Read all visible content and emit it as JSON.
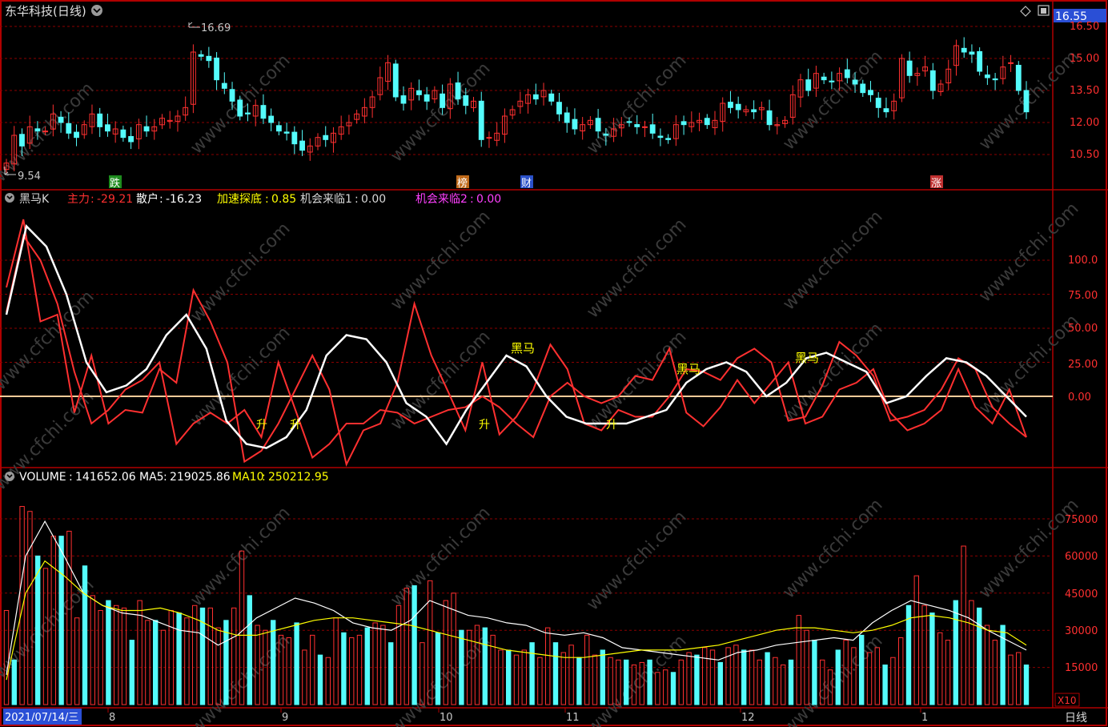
{
  "header": {
    "stock_title": "东华科技(日线)",
    "price_badge": "16.55",
    "high_label": "16.69",
    "low_label": "9.54"
  },
  "price_axis": [
    "16.50",
    "15.00",
    "13.50",
    "12.00",
    "10.50"
  ],
  "event_tags": [
    {
      "text": "跌",
      "color": "#1e8c1e"
    },
    {
      "text": "榜",
      "color": "#c06a1a"
    },
    {
      "text": "财",
      "color": "#2a50c8"
    },
    {
      "text": "涨",
      "color": "#c03030"
    }
  ],
  "indicator": {
    "name": "黑马K",
    "zhuli_label": "主力",
    "zhuli_value": "-29.21",
    "sanhu_label": "散户",
    "sanhu_value": "-16.23",
    "jiasu_label": "加速探底",
    "jiasu_value": "0.85",
    "jihui1_label": "机会来临1",
    "jihui1_value": "0.00",
    "jihui2_label": "机会来临2",
    "jihui2_value": "0.00",
    "axis": [
      "100.0",
      "75.00",
      "50.00",
      "25.00",
      "0.00"
    ],
    "marks": [
      "黑马",
      "黑马",
      "黑马",
      "升",
      "升",
      "升",
      "升"
    ]
  },
  "volume": {
    "label": "VOLUME",
    "value": "141652.06",
    "ma5_label": "MA5",
    "ma5_value": "219025.86",
    "ma10_label": "MA10",
    "ma10_value": "250212.95",
    "axis": [
      "75000",
      "60000",
      "45000",
      "30000",
      "15000"
    ],
    "unit": "X10"
  },
  "date_axis": {
    "current_date": "2021/07/14/三",
    "months": [
      "8",
      "9",
      "10",
      "11",
      "12",
      "1"
    ],
    "period": "日线"
  },
  "watermark": "www.cfchi.com",
  "colors": {
    "up": "#ff3030",
    "down": "#54fcfc",
    "white": "#ffffff",
    "yellow": "#ffff00",
    "magenta": "#ff40ff",
    "grid": "#8b0000"
  },
  "chart_data": [
    {
      "type": "candlestick",
      "title": "东华科技(日线)",
      "ylim": [
        9.54,
        16.69
      ],
      "y_ticks": [
        10.5,
        12.0,
        13.5,
        15.0,
        16.5
      ],
      "close": [
        10.1,
        11.4,
        10.9,
        11.8,
        11.6,
        11.6,
        12.4,
        12.0,
        11.5,
        11.3,
        11.9,
        12.4,
        11.8,
        11.6,
        11.7,
        11.3,
        11.1,
        11.9,
        11.6,
        11.8,
        12.2,
        12.1,
        12.3,
        12.7,
        15.3,
        15.1,
        14.9,
        14.0,
        13.6,
        13.0,
        12.3,
        12.4,
        12.8,
        12.2,
        12.0,
        11.6,
        11.5,
        11.0,
        10.7,
        10.9,
        11.3,
        11.2,
        11.5,
        11.8,
        12.0,
        12.4,
        12.7,
        13.2,
        14.1,
        14.8,
        13.2,
        12.9,
        13.6,
        13.3,
        13.0,
        13.5,
        12.7,
        13.8,
        13.1,
        12.8,
        13.0,
        11.2,
        11.3,
        11.5,
        12.3,
        12.6,
        13.0,
        13.3,
        13.1,
        13.5,
        13.0,
        12.4,
        12.0,
        11.7,
        11.9,
        12.1,
        11.6,
        11.4,
        11.7,
        11.9,
        12.0,
        11.8,
        11.8,
        11.5,
        11.3,
        11.2,
        11.9,
        11.9,
        12.0,
        12.1,
        11.9,
        12.1,
        12.9,
        12.7,
        12.6,
        12.6,
        12.5,
        12.7,
        11.9,
        11.9,
        12.1,
        13.3,
        14.0,
        13.5,
        14.3,
        14.0,
        13.9,
        14.3,
        14.1,
        13.8,
        13.4,
        13.3,
        12.7,
        12.5,
        13.0,
        15.0,
        14.2,
        14.3,
        14.6,
        13.5,
        13.8,
        14.5,
        15.6,
        15.3,
        15.2,
        14.4,
        14.1,
        14.0,
        14.6,
        14.8,
        13.5,
        12.5
      ]
    },
    {
      "type": "line",
      "title": "黑马K",
      "ylim": [
        -30,
        130
      ],
      "y_ticks": [
        0,
        25,
        50,
        75,
        100
      ],
      "series": [
        {
          "name": "主力",
          "values": [
            80,
            130,
            55,
            60,
            -12,
            30,
            -20,
            -10,
            -12,
            20,
            10,
            78,
            55,
            25,
            -48,
            -40,
            -20,
            5,
            30,
            5,
            -50,
            -25,
            -20,
            10,
            68,
            30,
            3,
            -25,
            25,
            -28,
            -15,
            5,
            38,
            20,
            -20,
            -25,
            -10,
            -15,
            -15,
            0,
            20,
            18,
            12,
            28,
            35,
            25,
            -18,
            -15,
            8,
            40,
            30,
            15,
            -18,
            -15,
            -10,
            5,
            28,
            20,
            -8,
            -20,
            -30
          ]
        },
        {
          "name": "散户",
          "values": [
            62,
            118,
            100,
            68,
            18,
            -20,
            -10,
            5,
            12,
            25,
            -35,
            -20,
            -12,
            -20,
            -10,
            -30,
            25,
            -10,
            -45,
            -35,
            -20,
            -20,
            -10,
            -12,
            -20,
            -15,
            -10,
            -8,
            0,
            -8,
            -20,
            -30,
            0,
            10,
            0,
            -5,
            0,
            15,
            12,
            35,
            -12,
            -22,
            -8,
            12,
            -5,
            10,
            25,
            -20,
            -15,
            5,
            10,
            20,
            -12,
            -25,
            -20,
            -10,
            20,
            -8,
            -20,
            5,
            -30
          ]
        },
        {
          "name": "白线",
          "values": [
            60,
            125,
            110,
            75,
            25,
            3,
            8,
            20,
            45,
            60,
            35,
            -18,
            -35,
            -38,
            -30,
            -10,
            30,
            45,
            42,
            25,
            -5,
            -15,
            -35,
            -10,
            10,
            30,
            22,
            0,
            -15,
            -20,
            -20,
            -20,
            -15,
            -10,
            10,
            20,
            25,
            18,
            0,
            10,
            28,
            32,
            25,
            18,
            -5,
            0,
            15,
            28,
            25,
            15,
            0,
            -15
          ]
        }
      ]
    },
    {
      "type": "bar",
      "title": "VOLUME",
      "ylim": [
        0,
        85000
      ],
      "y_ticks": [
        15000,
        30000,
        45000,
        60000,
        75000
      ],
      "series": [
        {
          "name": "VOLUME",
          "values": [
            38000,
            18000,
            80000,
            78000,
            60000,
            55000,
            68000,
            68000,
            70000,
            35000,
            56000,
            44000,
            38000,
            42000,
            40000,
            39000,
            26000,
            42000,
            34000,
            34000,
            30000,
            38000,
            37000,
            35000,
            40000,
            39000,
            39000,
            31000,
            34000,
            39000,
            62000,
            44000,
            32000,
            30000,
            34000,
            28000,
            27000,
            33000,
            22000,
            28000,
            20000,
            19000,
            35000,
            29000,
            27000,
            28000,
            31000,
            33000,
            32000,
            25000,
            40000,
            47000,
            48000,
            25000,
            50000,
            29000,
            42000,
            45000,
            30000,
            30000,
            32000,
            31000,
            28000,
            22000,
            22000,
            20000,
            22000,
            25000,
            19000,
            31000,
            25000,
            21000,
            24000,
            19000,
            28000,
            20000,
            22000,
            19000,
            18000,
            18000,
            16000,
            17000,
            18000,
            13000,
            14000,
            13000,
            18000,
            21000,
            20000,
            23000,
            22000,
            17000,
            23000,
            24000,
            22000,
            22000,
            18000,
            21000,
            19000,
            16000,
            18000,
            36000,
            30000,
            26000,
            18000,
            14000,
            22000,
            26000,
            23000,
            28000,
            21000,
            23000,
            16000,
            19000,
            27000,
            40000,
            52000,
            40000,
            37000,
            29000,
            26000,
            42000,
            64000,
            42000,
            39000,
            32000,
            26000,
            32000,
            20000,
            21000,
            16000
          ]
        },
        {
          "name": "MA5",
          "values": [
            12000,
            60000,
            74000,
            60000,
            45000,
            40000,
            37000,
            36000,
            33000,
            30000,
            29000,
            24000,
            28000,
            35000,
            39000,
            43000,
            41000,
            38000,
            33000,
            31000,
            30000,
            34000,
            42000,
            39000,
            36000,
            35000,
            33000,
            32000,
            29000,
            28000,
            29000,
            27000,
            23000,
            22000,
            21000,
            20000,
            19000,
            18000,
            21000,
            22000,
            24000,
            25000,
            26000,
            27000,
            26000,
            33000,
            38000,
            42000,
            40000,
            38000,
            35000,
            30000,
            26000,
            22000
          ]
        },
        {
          "name": "MA10",
          "values": [
            10000,
            45000,
            58000,
            52000,
            45000,
            40000,
            38000,
            38000,
            39000,
            37000,
            34000,
            30000,
            28000,
            28000,
            30000,
            32000,
            34000,
            35000,
            35000,
            34000,
            33000,
            32000,
            30000,
            28000,
            26000,
            24000,
            22000,
            21000,
            20000,
            19000,
            19000,
            20000,
            21000,
            22000,
            22000,
            22000,
            23000,
            24000,
            26000,
            28000,
            30000,
            31000,
            31000,
            30000,
            29000,
            30000,
            32000,
            35000,
            36000,
            35000,
            33000,
            30000,
            29000,
            24000
          ]
        }
      ]
    }
  ]
}
